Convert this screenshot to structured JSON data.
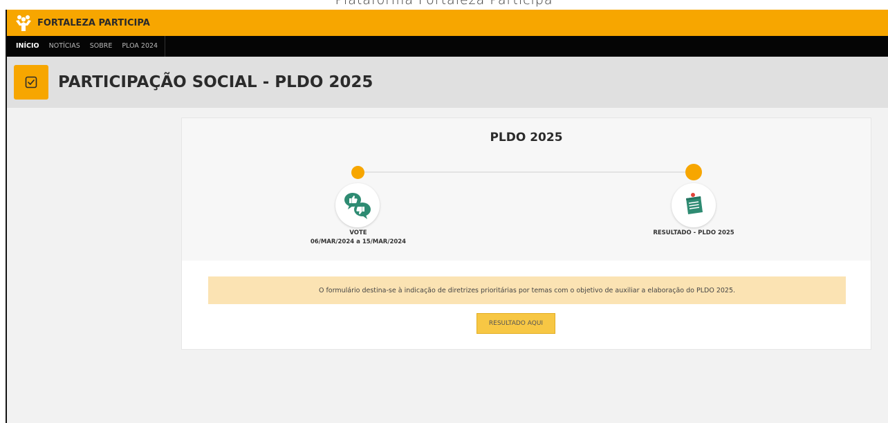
{
  "caption": "Plataforma Fortaleza Participa",
  "brand": {
    "name": "FORTALEZA PARTICIPA",
    "color": "#F7A600"
  },
  "nav": {
    "items": [
      {
        "label": "INÍCIO",
        "active": true
      },
      {
        "label": "NOTÍCIAS",
        "active": false
      },
      {
        "label": "SOBRE",
        "active": false
      },
      {
        "label": "PLOA 2024",
        "active": false
      }
    ]
  },
  "page": {
    "title": "PARTICIPAÇÃO SOCIAL - PLDO 2025",
    "icon": "checkbox-icon"
  },
  "card": {
    "title": "PLDO 2025",
    "steps": [
      {
        "label": "VOTE",
        "dates": "06/MAR/2024 a 15/MAR/2024",
        "icon": "vote-thumbs-icon"
      },
      {
        "label": "RESULTADO - PLDO 2025",
        "icon": "notepad-icon"
      }
    ],
    "notice": "O formulário destina-se à indicação de diretrizes prioritárias por temas com o objetivo de auxiliar a elaboração do PLDO 2025.",
    "button_label": "RESULTADO AQUI"
  },
  "colors": {
    "accent": "#F7A600",
    "nav_bg": "#050505",
    "notice_bg": "#FBE3B3",
    "button_bg": "#F7C744",
    "icon_green": "#2E8B72"
  }
}
